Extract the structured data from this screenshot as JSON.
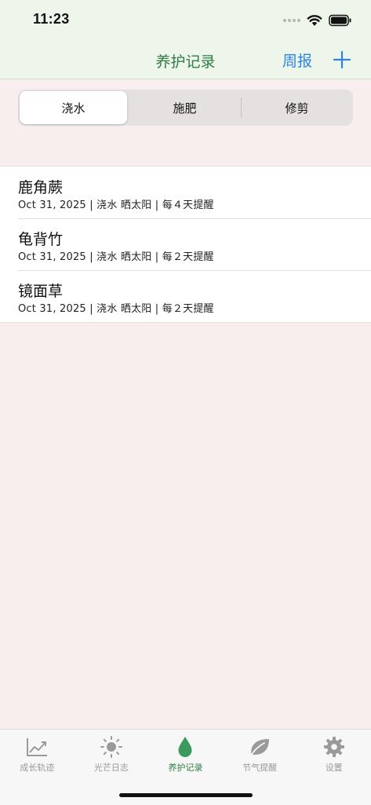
{
  "status_bar": {
    "time": "11:23"
  },
  "nav": {
    "title": "养护记录",
    "weekly_label": "周报",
    "add_icon": "plus-icon"
  },
  "segments": [
    {
      "label": "浇水",
      "selected": true
    },
    {
      "label": "施肥",
      "selected": false
    },
    {
      "label": "修剪",
      "selected": false
    }
  ],
  "records": [
    {
      "name": "鹿角蕨",
      "detail": "Oct 31, 2025 | 浇水 晒太阳 | 每４天提醒"
    },
    {
      "name": "龟背竹",
      "detail": "Oct 31, 2025 | 浇水 晒太阳 | 每２天提醒"
    },
    {
      "name": "镜面草",
      "detail": "Oct 31, 2025 | 浇水 晒太阳 | 每２天提醒"
    }
  ],
  "tabs": [
    {
      "label": "成长轨迹",
      "icon": "chart-line-icon"
    },
    {
      "label": "光芒日志",
      "icon": "sun-icon"
    },
    {
      "label": "养护记录",
      "icon": "drop-icon",
      "active": true
    },
    {
      "label": "节气提醒",
      "icon": "leaf-icon"
    },
    {
      "label": "设置",
      "icon": "gear-icon"
    }
  ],
  "colors": {
    "accent_green": "#2f7d44",
    "link_blue": "#2a84e0",
    "background": "#f9eeee",
    "header_bg": "#eef6ec"
  }
}
